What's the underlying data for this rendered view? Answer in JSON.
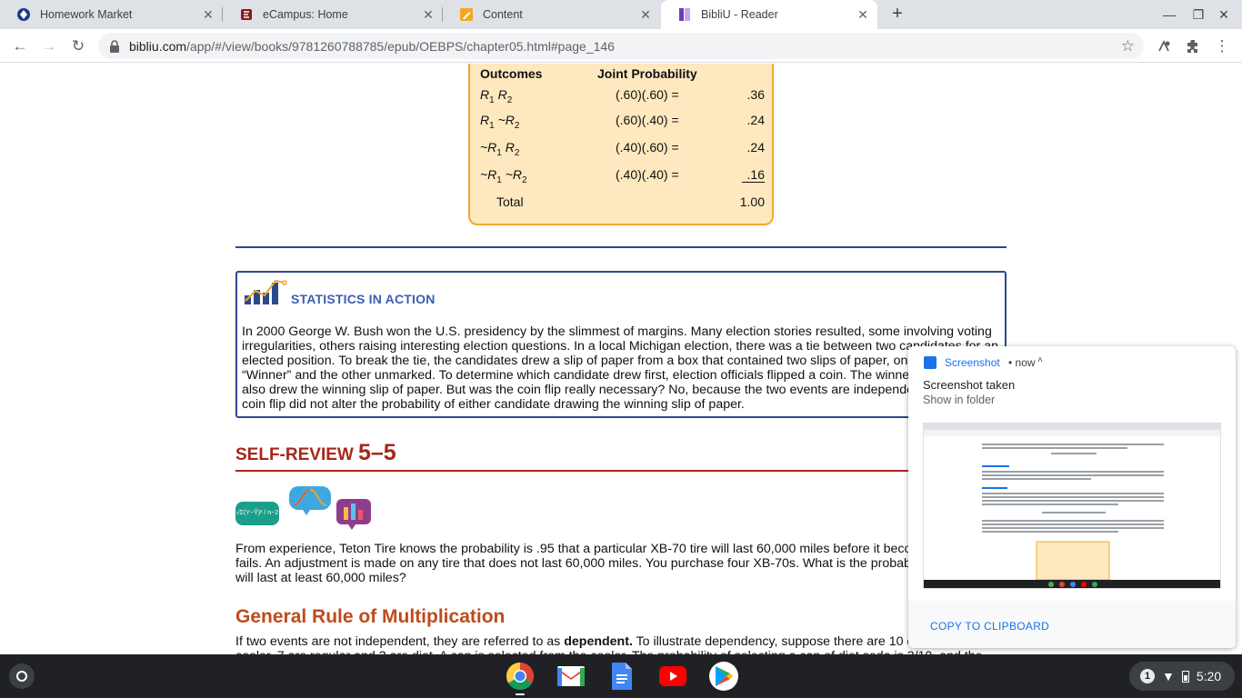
{
  "tabs": [
    {
      "title": "Homework Market"
    },
    {
      "title": "eCampus: Home"
    },
    {
      "title": "Content"
    },
    {
      "title": "BibliU - Reader"
    }
  ],
  "address": {
    "host": "bibliu.com",
    "path": "/app/#/view/books/9781260788785/epub/OEBPS/chapter05.html#page_146"
  },
  "prob_table": {
    "col_outcomes": "Outcomes",
    "col_joint": "Joint Probability",
    "rows": [
      {
        "o1": "R",
        "s1": "1",
        "o2": " R",
        "s2": "2",
        "expr": "(.60)(.60) =",
        "value": ".36"
      },
      {
        "o1": "R",
        "s1": "1",
        "o2": " ~R",
        "s2": "2",
        "expr": "(.60)(.40) =",
        "value": ".24"
      },
      {
        "o1": "~R",
        "s1": "1",
        "o2": " R",
        "s2": "2",
        "expr": "(.40)(.60) =",
        "value": ".24"
      },
      {
        "o1": "~R",
        "s1": "1",
        "o2": " ~R",
        "s2": "2",
        "expr": "(.40)(.40) =",
        "value": ".16"
      }
    ],
    "total_label": "Total",
    "total_value": "1.00"
  },
  "sia": {
    "title": "STATISTICS IN ACTION",
    "body": "In 2000 George W. Bush won the U.S. presidency by the slimmest of margins. Many election stories resulted, some involving voting irregularities, others raising interesting election questions. In a local Michigan election, there was a tie between two candidates for an elected position. To break the tie, the candidates drew a slip of paper from a box that contained two slips of paper, one marked “Winner” and the other unmarked. To determine which candidate drew first, election officials flipped a coin. The winner of the coin flip also drew the winning slip of paper. But was the coin flip really necessary? No, because the two events are independent. Winning the coin flip did not alter the probability of either candidate drawing the winning slip of paper."
  },
  "self_review": {
    "label": "SELF-REVIEW",
    "number": "5–5",
    "badge_formula": "√Σ(Y−Ŷ)² / n−2",
    "text": "From experience, Teton Tire knows the probability is .95 that a particular XB-70 tire will last 60,000 miles before it becomes bald or fails. An adjustment is made on any tire that does not last 60,000 miles. You purchase four XB-70s. What is the probability all four tires will last at least 60,000 miles?"
  },
  "general_rule": {
    "heading": "General Rule of Multiplication",
    "text_before": "If two events are not independent, they are referred to as ",
    "text_bold": "dependent.",
    "text_after": " To illustrate dependency, suppose there are 10 cans of soda in a cooler, 7 are regular and 3 are diet. A can is selected from the cooler. The probability of selecting a can of diet soda is 3/10, and the"
  },
  "notification": {
    "app": "Screenshot",
    "time": "• now",
    "title": "Screenshot taken",
    "subtitle": "Show in folder",
    "action": "COPY TO CLIPBOARD"
  },
  "shelf": {
    "notif_count": "1",
    "clock": "5:20"
  },
  "colors": {
    "accent_blue": "#1a73e8",
    "table_fill": "#fde8bf",
    "table_border": "#f0a830",
    "heading_red": "#a8261a",
    "heading_orange": "#c04a1c",
    "sia_blue": "#3b5fb0"
  },
  "icons": [
    "homework-market-favicon",
    "ecampus-favicon",
    "content-favicon",
    "bibliu-favicon",
    "close-icon",
    "plus-icon",
    "back-icon",
    "forward-icon",
    "reload-icon",
    "lock-icon",
    "star-icon",
    "extension-icon",
    "menu-icon",
    "chrome-icon",
    "gmail-icon",
    "docs-icon",
    "youtube-icon",
    "play-store-icon",
    "wifi-icon",
    "battery-icon"
  ]
}
